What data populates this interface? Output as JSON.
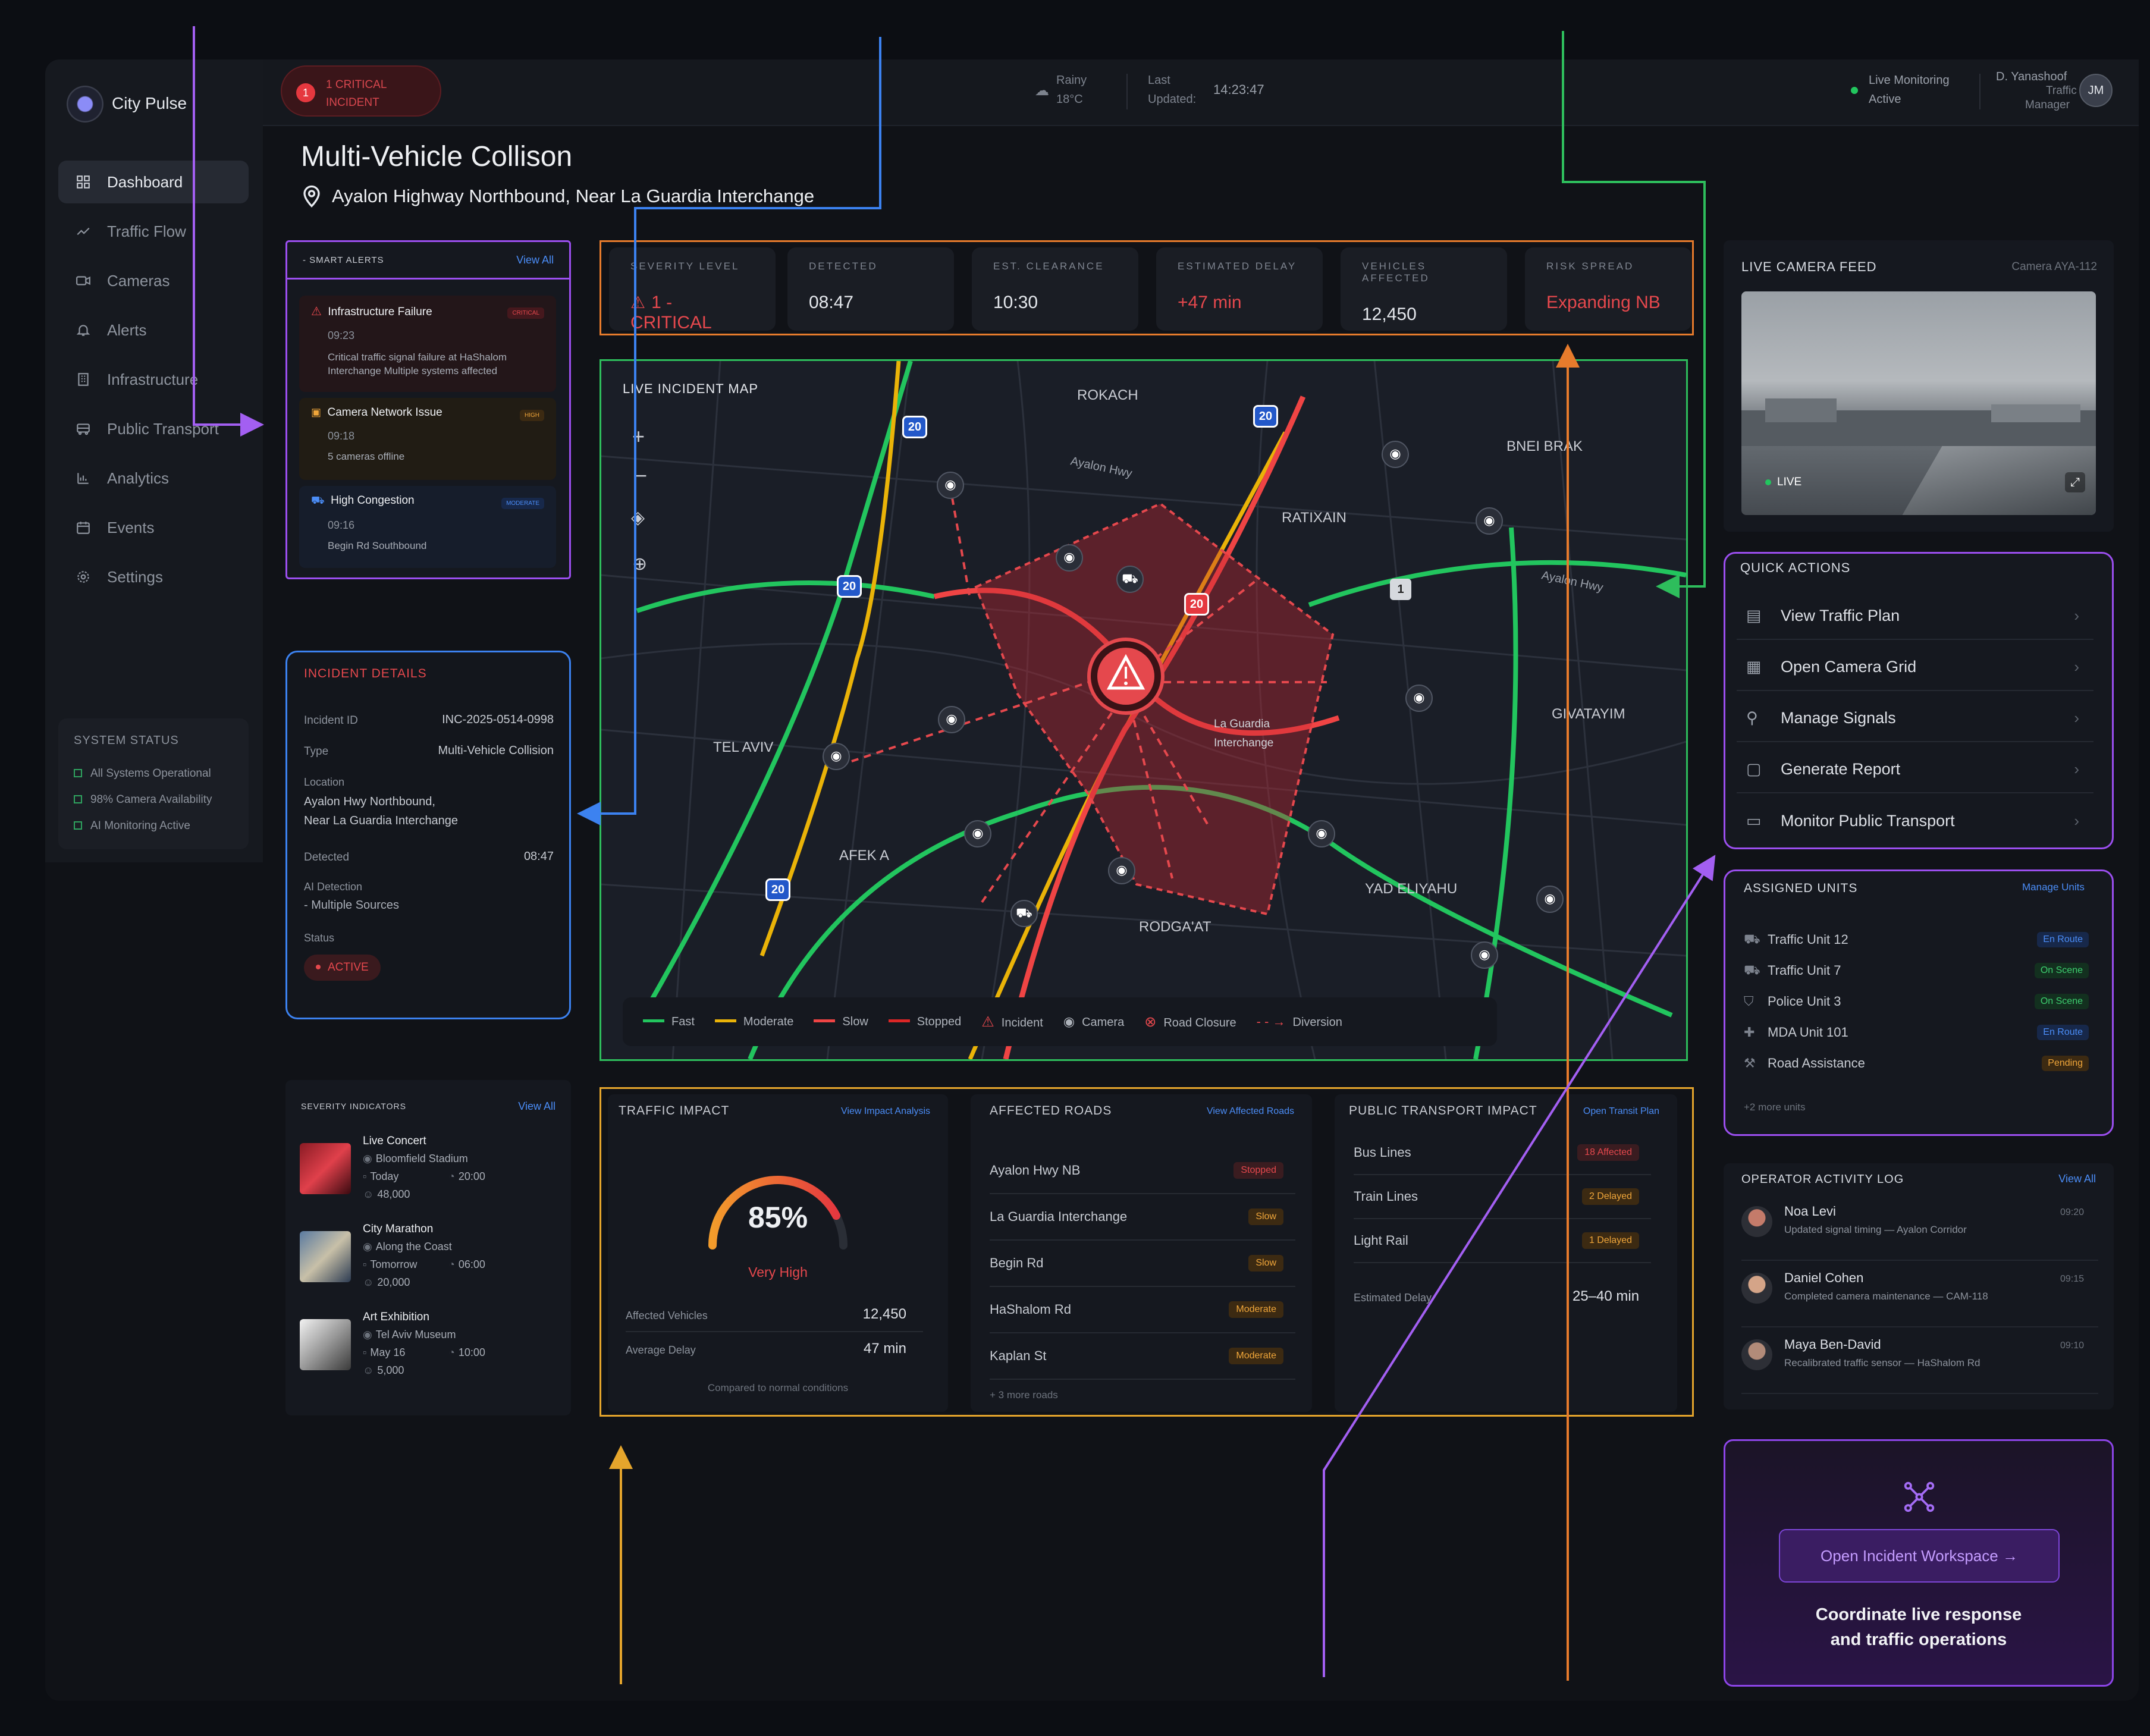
{
  "app": {
    "name": "City Pulse"
  },
  "topbar": {
    "critical_count": "1",
    "critical_text": "1 CRITICAL INCIDENT",
    "weather_cond": "Rainy",
    "weather_temp": "18°C",
    "last_label_1": "Last",
    "last_label_2": "Updated:",
    "last_time": "14:23:47",
    "monitor_1": "Live Monitoring",
    "monitor_2": "Active",
    "user_name": "D. Yanashoof",
    "user_role_1": "Traffic",
    "user_role_2": "Manager",
    "user_initials": "JM"
  },
  "sidebar": {
    "items": [
      {
        "label": "Dashboard",
        "icon": "grid-icon"
      },
      {
        "label": "Traffic Flow",
        "icon": "trend-icon"
      },
      {
        "label": "Cameras",
        "icon": "camera-icon"
      },
      {
        "label": "Alerts",
        "icon": "bell-icon"
      },
      {
        "label": "Infrastructure",
        "icon": "building-icon"
      },
      {
        "label": "Public Transport",
        "icon": "bus-icon"
      },
      {
        "label": "Analytics",
        "icon": "chart-icon"
      },
      {
        "label": "Events",
        "icon": "calendar-icon"
      },
      {
        "label": "Settings",
        "icon": "gear-icon"
      }
    ],
    "status_title": "SYSTEM STATUS",
    "status_items": [
      "All Systems Operational",
      "98% Camera Availability",
      "AI Monitoring Active"
    ]
  },
  "page": {
    "title": "Multi-Vehicle Collison",
    "location": "Ayalon Highway Northbound, Near La Guardia Interchange"
  },
  "smart_alerts": {
    "title": "- SMART ALERTS",
    "view_all": "View All",
    "items": [
      {
        "title": "Infrastructure Failure",
        "badge": "CRITICAL",
        "time": "09:23",
        "desc": "Critical traffic signal failure at HaShalom Interchange Multiple systems affected"
      },
      {
        "title": "Camera Network Issue",
        "badge": "HIGH",
        "time": "09:18",
        "desc": "5 cameras offline"
      },
      {
        "title": "High Congestion",
        "badge": "MODERATE",
        "time": "09:16",
        "desc": "Begin Rd Southbound"
      }
    ]
  },
  "incident_details": {
    "title": "INCIDENT DETAILS",
    "id_label": "Incident ID",
    "id_value": "INC-2025-0514-0998",
    "type_label": "Type",
    "type_value": "Multi-Vehicle Collision",
    "location_label": "Location",
    "location_value_1": "Ayalon Hwy Northbound,",
    "location_value_2": "Near La Guardia Interchange",
    "detected_label": "Detected",
    "detected_value": "08:47",
    "ai_label": "AI Detection",
    "ai_value": "- Multiple Sources",
    "status_label": "Status",
    "status_value": "ACTIVE"
  },
  "severity_indicators": {
    "title": "SEVERITY INDICATORS",
    "view_all": "View All",
    "events": [
      {
        "name": "Live Concert",
        "place": "Bloomfield Stadium",
        "day": "Today",
        "time": "20:00",
        "people": "48,000"
      },
      {
        "name": "City Marathon",
        "place": "Along the Coast",
        "day": "Tomorrow",
        "time": "06:00",
        "people": "20,000"
      },
      {
        "name": "Art Exhibition",
        "place": "Tel Aviv Museum",
        "day": "May 16",
        "time": "10:00",
        "people": "5,000"
      }
    ]
  },
  "kpis": [
    {
      "label": "SEVERITY LEVEL",
      "value": "1 - CRITICAL"
    },
    {
      "label": "DETECTED",
      "value": "08:47"
    },
    {
      "label": "EST. CLEARANCE",
      "value": "10:30"
    },
    {
      "label": "ESTIMATED DELAY",
      "value": "+47 min"
    },
    {
      "label": "VEHICLES AFFECTED",
      "value": "12,450"
    },
    {
      "label": "RISK SPREAD",
      "value": "Expanding NB"
    }
  ],
  "map": {
    "title": "LIVE INCIDENT MAP",
    "areas": [
      "ROKACH",
      "BNEI BRAK",
      "RATIXAIN",
      "TEL AVIV",
      "GIVATAYIM",
      "AFEK A",
      "YAD ELIYAHU",
      "RODGA'AT"
    ],
    "road_labels": [
      "Ayalon Hwy",
      "Ayalon Hwy"
    ],
    "interchange": [
      "La Guardia",
      "Interchange"
    ],
    "shields": [
      "20",
      "20",
      "20",
      "20",
      "20",
      "1"
    ],
    "legend": [
      "Fast",
      "Moderate",
      "Slow",
      "Stopped",
      "Incident",
      "Camera",
      "Road Closure",
      "Diversion"
    ],
    "colors": {
      "fast": "#22c55e",
      "moderate": "#eab308",
      "slow": "#ef4444",
      "stopped": "#dc2626"
    }
  },
  "traffic_impact": {
    "title": "TRAFFIC IMPACT",
    "link": "View Impact Analysis",
    "gauge_value": "85%",
    "gauge_fraction": 0.85,
    "gauge_label": "Very High",
    "vehicles_label": "Affected Vehicles",
    "vehicles_value": "12,450",
    "delay_label": "Average Delay",
    "delay_value": "47 min",
    "footnote": "Compared to normal conditions"
  },
  "affected_roads": {
    "title": "AFFECTED ROADS",
    "link": "View Affected Roads",
    "rows": [
      {
        "name": "Ayalon Hwy NB",
        "status": "Stopped"
      },
      {
        "name": "La Guardia Interchange",
        "status": "Slow"
      },
      {
        "name": "Begin Rd",
        "status": "Slow"
      },
      {
        "name": "HaShalom Rd",
        "status": "Moderate"
      },
      {
        "name": "Kaplan St",
        "status": "Moderate"
      }
    ],
    "more": "+ 3 more roads"
  },
  "transport_impact": {
    "title": "PUBLIC TRANSPORT IMPACT",
    "link": "Open Transit Plan",
    "rows": [
      {
        "name": "Bus Lines",
        "status": "18 Affected"
      },
      {
        "name": "Train Lines",
        "status": "2 Delayed"
      },
      {
        "name": "Light Rail",
        "status": "1 Delayed"
      }
    ],
    "delay_label": "Estimated Delay",
    "delay_value": "25–40 min"
  },
  "camera_feed": {
    "title": "LIVE CAMERA FEED",
    "camera_id": "Camera AYA-112",
    "live": "LIVE"
  },
  "quick_actions": {
    "title": "QUICK ACTIONS",
    "items": [
      {
        "label": "View Traffic Plan",
        "icon": "map-icon"
      },
      {
        "label": "Open Camera Grid",
        "icon": "grid-icon"
      },
      {
        "label": "Manage Signals",
        "icon": "signal-icon"
      },
      {
        "label": "Generate Report",
        "icon": "report-icon"
      },
      {
        "label": "Monitor Public Transport",
        "icon": "bus-icon"
      }
    ]
  },
  "assigned_units": {
    "title": "ASSIGNED UNITS",
    "link": "Manage Units",
    "units": [
      {
        "name": "Traffic Unit 12",
        "status": "En Route"
      },
      {
        "name": "Traffic Unit 7",
        "status": "On Scene"
      },
      {
        "name": "Police Unit 3",
        "status": "On Scene"
      },
      {
        "name": "MDA Unit 101",
        "status": "En Route"
      },
      {
        "name": "Road Assistance",
        "status": "Pending"
      }
    ],
    "more": "+2 more units"
  },
  "activity_log": {
    "title": "OPERATOR ACTIVITY LOG",
    "link": "View All",
    "entries": [
      {
        "name": "Noa Levi",
        "time": "09:20",
        "text": "Updated signal timing — Ayalon Corridor"
      },
      {
        "name": "Daniel Cohen",
        "time": "09:15",
        "text": "Completed camera maintenance — CAM-118"
      },
      {
        "name": "Maya Ben-David",
        "time": "09:10",
        "text": "Recalibrated traffic sensor — HaShalom Rd"
      }
    ]
  },
  "workspace": {
    "button": "Open Incident Workspace →",
    "caption_1": "Coordinate live response",
    "caption_2": "and traffic operations"
  }
}
